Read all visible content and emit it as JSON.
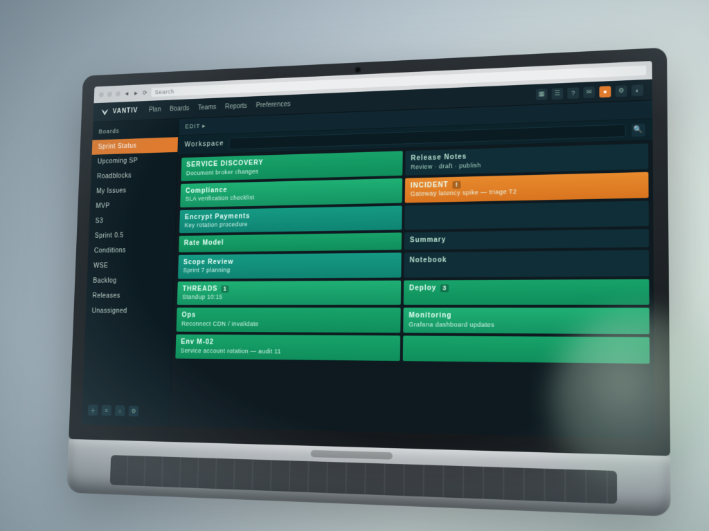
{
  "browser": {
    "address": "Search"
  },
  "app": {
    "brand": "VANTIV",
    "menu": [
      "Plan",
      "Boards",
      "Teams",
      "Reports",
      "Preferences"
    ]
  },
  "sidebar": {
    "header": "Boards",
    "items": [
      {
        "label": "Sprint Status",
        "active": true
      },
      {
        "label": "Upcoming SP"
      },
      {
        "label": "Roadblocks"
      },
      {
        "label": "My Issues"
      },
      {
        "label": "MVP"
      },
      {
        "label": "S3"
      },
      {
        "label": "Sprint 0.5"
      },
      {
        "label": "Conditions"
      },
      {
        "label": "WSE"
      },
      {
        "label": "Backlog"
      },
      {
        "label": "Releases"
      },
      {
        "label": "Unassigned"
      }
    ]
  },
  "context": {
    "label": "EDIT ▸"
  },
  "search": {
    "label": "Workspace",
    "placeholder": ""
  },
  "grid": {
    "rows": [
      {
        "left": {
          "style": "green",
          "title": "SERVICE DISCOVERY",
          "sub": "Document broker changes"
        },
        "right": {
          "style": "dark",
          "title": "Release Notes",
          "sub": "Review · draft · publish"
        }
      },
      {
        "left": {
          "style": "green2",
          "title": "Compliance",
          "sub": "SLA verification checklist"
        },
        "right": {
          "style": "orange",
          "title": "INCIDENT",
          "sub": "Gateway latency spike — triage T2",
          "badge": "!"
        }
      },
      {
        "left": {
          "style": "teal",
          "title": "Encrypt Payments",
          "sub": "Key rotation procedure"
        },
        "right": {
          "style": "dark",
          "title": "",
          "sub": ""
        }
      },
      {
        "left": {
          "style": "green",
          "title": "Rate Model",
          "sub": ""
        },
        "right": {
          "style": "dark",
          "title": "Summary",
          "sub": ""
        }
      },
      {
        "left": {
          "style": "teal",
          "title": "Scope Review",
          "sub": "Sprint 7 planning"
        },
        "right": {
          "style": "dark",
          "title": "Notebook",
          "sub": ""
        }
      },
      {
        "left": {
          "style": "green2",
          "title": "THREADS",
          "sub": "Standup 10:15",
          "badge": "1"
        },
        "right": {
          "style": "green",
          "title": "Deploy",
          "sub": "",
          "badge": "3"
        }
      },
      {
        "left": {
          "style": "green",
          "title": "Ops",
          "sub": "Reconnect CDN / invalidate"
        },
        "right": {
          "style": "green2",
          "title": "Monitoring",
          "sub": "Grafana dashboard updates"
        }
      },
      {
        "left": {
          "style": "green",
          "title": "Env M-02",
          "sub": "Service account rotation — audit 11"
        },
        "right": {
          "style": "green",
          "title": "",
          "sub": ""
        }
      }
    ]
  }
}
